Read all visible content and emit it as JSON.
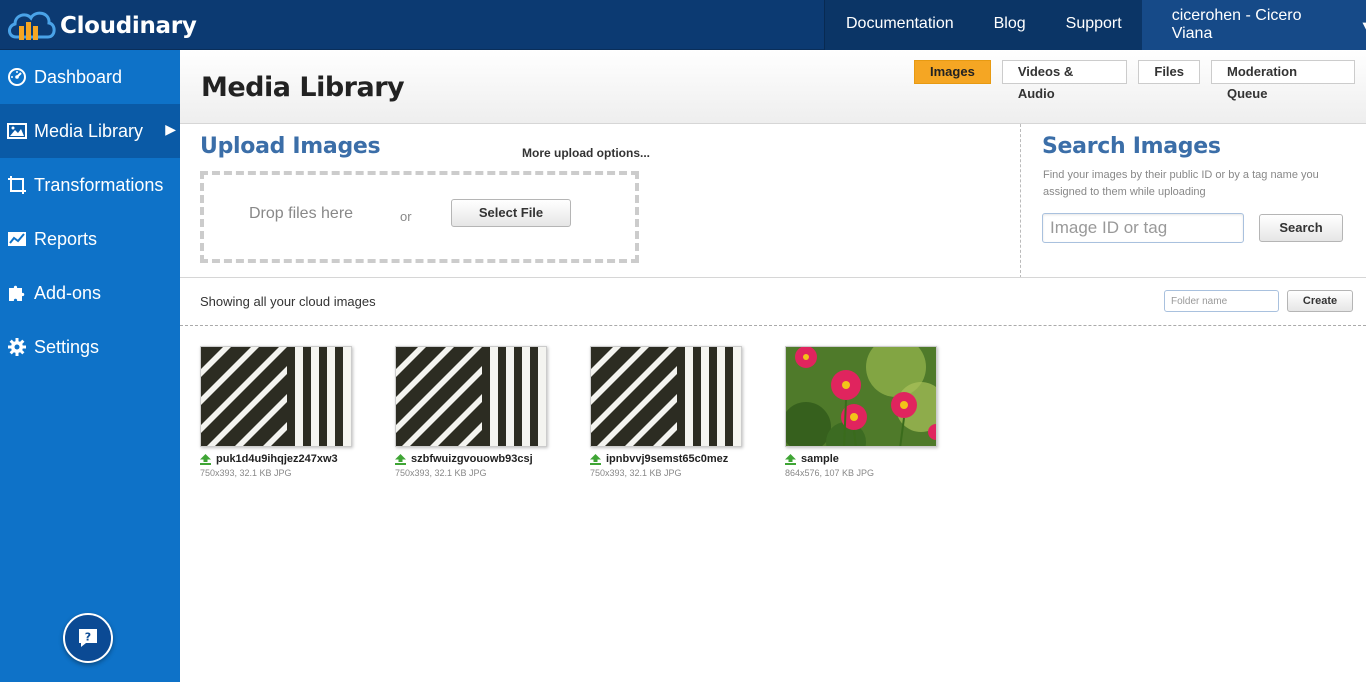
{
  "brand": {
    "name": "Cloudinary"
  },
  "topnav": {
    "links": [
      "Documentation",
      "Blog",
      "Support"
    ],
    "user": "cicerohen - Cicero Viana",
    "caret": "▼"
  },
  "sidebar": {
    "items": [
      {
        "label": "Dashboard",
        "icon": "dashboard-gauge-icon"
      },
      {
        "label": "Media Library",
        "icon": "image-icon"
      },
      {
        "label": "Transformations",
        "icon": "crop-icon"
      },
      {
        "label": "Reports",
        "icon": "chart-icon"
      },
      {
        "label": "Add-ons",
        "icon": "puzzle-icon"
      },
      {
        "label": "Settings",
        "icon": "gear-icon"
      }
    ],
    "active_arrow": "▶",
    "help_icon": "help-chat-icon"
  },
  "header": {
    "title": "Media Library",
    "tabs": [
      "Images",
      "Videos & Audio",
      "Files",
      "Moderation Queue"
    ]
  },
  "upload": {
    "title": "Upload Images",
    "more_options": "More upload options...",
    "drop_text": "Drop files here",
    "or_text": "or",
    "select_file": "Select File"
  },
  "search": {
    "title": "Search Images",
    "description": "Find your images by their public ID or by a tag name you assigned to them while uploading",
    "placeholder": "Image ID or tag",
    "button": "Search"
  },
  "toolbar": {
    "showing": "Showing all your cloud images",
    "folder_placeholder": "Folder name",
    "create": "Create"
  },
  "assets": [
    {
      "name": "puk1d4u9ihqjez247xw3",
      "meta": "750x393, 32.1 KB JPG",
      "kind": "stripes"
    },
    {
      "name": "szbfwuizgvouowb93csj",
      "meta": "750x393, 32.1 KB JPG",
      "kind": "stripes"
    },
    {
      "name": "ipnbvvj9semst65c0mez",
      "meta": "750x393, 32.1 KB JPG",
      "kind": "stripes"
    },
    {
      "name": "sample",
      "meta": "864x576, 107 KB JPG",
      "kind": "flowers"
    }
  ],
  "colors": {
    "topbar": "#0c3a72",
    "sidebar": "#0e72c8",
    "active_tab": "#f5a623",
    "heading_blue": "#3b6ea8",
    "upload_green": "#3fa535"
  }
}
